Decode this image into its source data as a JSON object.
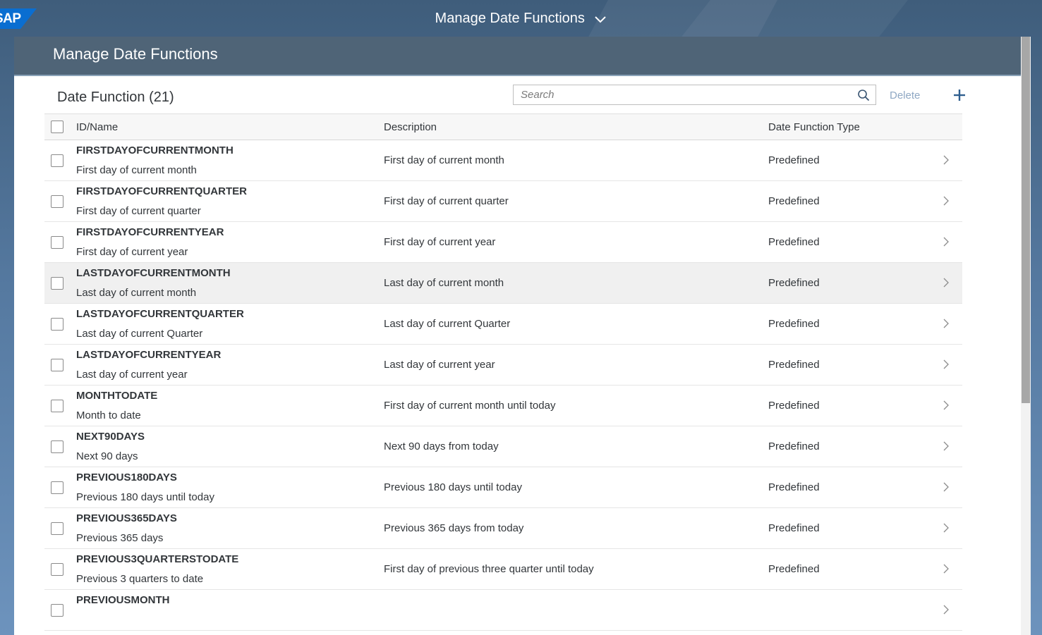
{
  "shell": {
    "logo": "SAP",
    "title": "Manage Date Functions",
    "title_icon": "chevron-down-icon"
  },
  "page": {
    "title": "Manage Date Functions"
  },
  "toolbar": {
    "table_title": "Date Function (21)",
    "search_placeholder": "Search",
    "search_icon": "search-icon",
    "delete_label": "Delete",
    "add_icon": "plus-icon"
  },
  "table": {
    "columns": [
      "ID/Name",
      "Description",
      "Date Function Type"
    ],
    "rows": [
      {
        "id": "FIRSTDAYOFCURRENTMONTH",
        "name": "First day of current month",
        "description": "First day of current month",
        "type": "Predefined"
      },
      {
        "id": "FIRSTDAYOFCURRENTQUARTER",
        "name": "First day of current quarter",
        "description": "First day of current quarter",
        "type": "Predefined"
      },
      {
        "id": "FIRSTDAYOFCURRENTYEAR",
        "name": "First day of current year",
        "description": "First day of current year",
        "type": "Predefined"
      },
      {
        "id": "LASTDAYOFCURRENTMONTH",
        "name": "Last day of current month",
        "description": "Last day of current month",
        "type": "Predefined"
      },
      {
        "id": "LASTDAYOFCURRENTQUARTER",
        "name": "Last day of current Quarter",
        "description": "Last day of current Quarter",
        "type": "Predefined"
      },
      {
        "id": "LASTDAYOFCURRENTYEAR",
        "name": "Last day of current year",
        "description": "Last day of current year",
        "type": "Predefined"
      },
      {
        "id": "MONTHTODATE",
        "name": "Month to date",
        "description": "First day of current month until today",
        "type": "Predefined"
      },
      {
        "id": "NEXT90DAYS",
        "name": "Next 90 days",
        "description": "Next 90 days from today",
        "type": "Predefined"
      },
      {
        "id": "PREVIOUS180DAYS",
        "name": "Previous 180 days until today",
        "description": "Previous 180 days until today",
        "type": "Predefined"
      },
      {
        "id": "PREVIOUS365DAYS",
        "name": "Previous 365 days",
        "description": "Previous 365 days from today",
        "type": "Predefined"
      },
      {
        "id": "PREVIOUS3QUARTERSTODATE",
        "name": "Previous 3 quarters to date",
        "description": "First day of previous three quarter until today",
        "type": "Predefined"
      },
      {
        "id": "PREVIOUSMONTH",
        "name": "",
        "description": "",
        "type": ""
      }
    ]
  },
  "colors": {
    "shell_bg": "#3f5d7b",
    "page_header": "#374e64",
    "accent": "#0a6ed1",
    "text": "#32363a",
    "delete_disabled": "#8fa8c4"
  }
}
